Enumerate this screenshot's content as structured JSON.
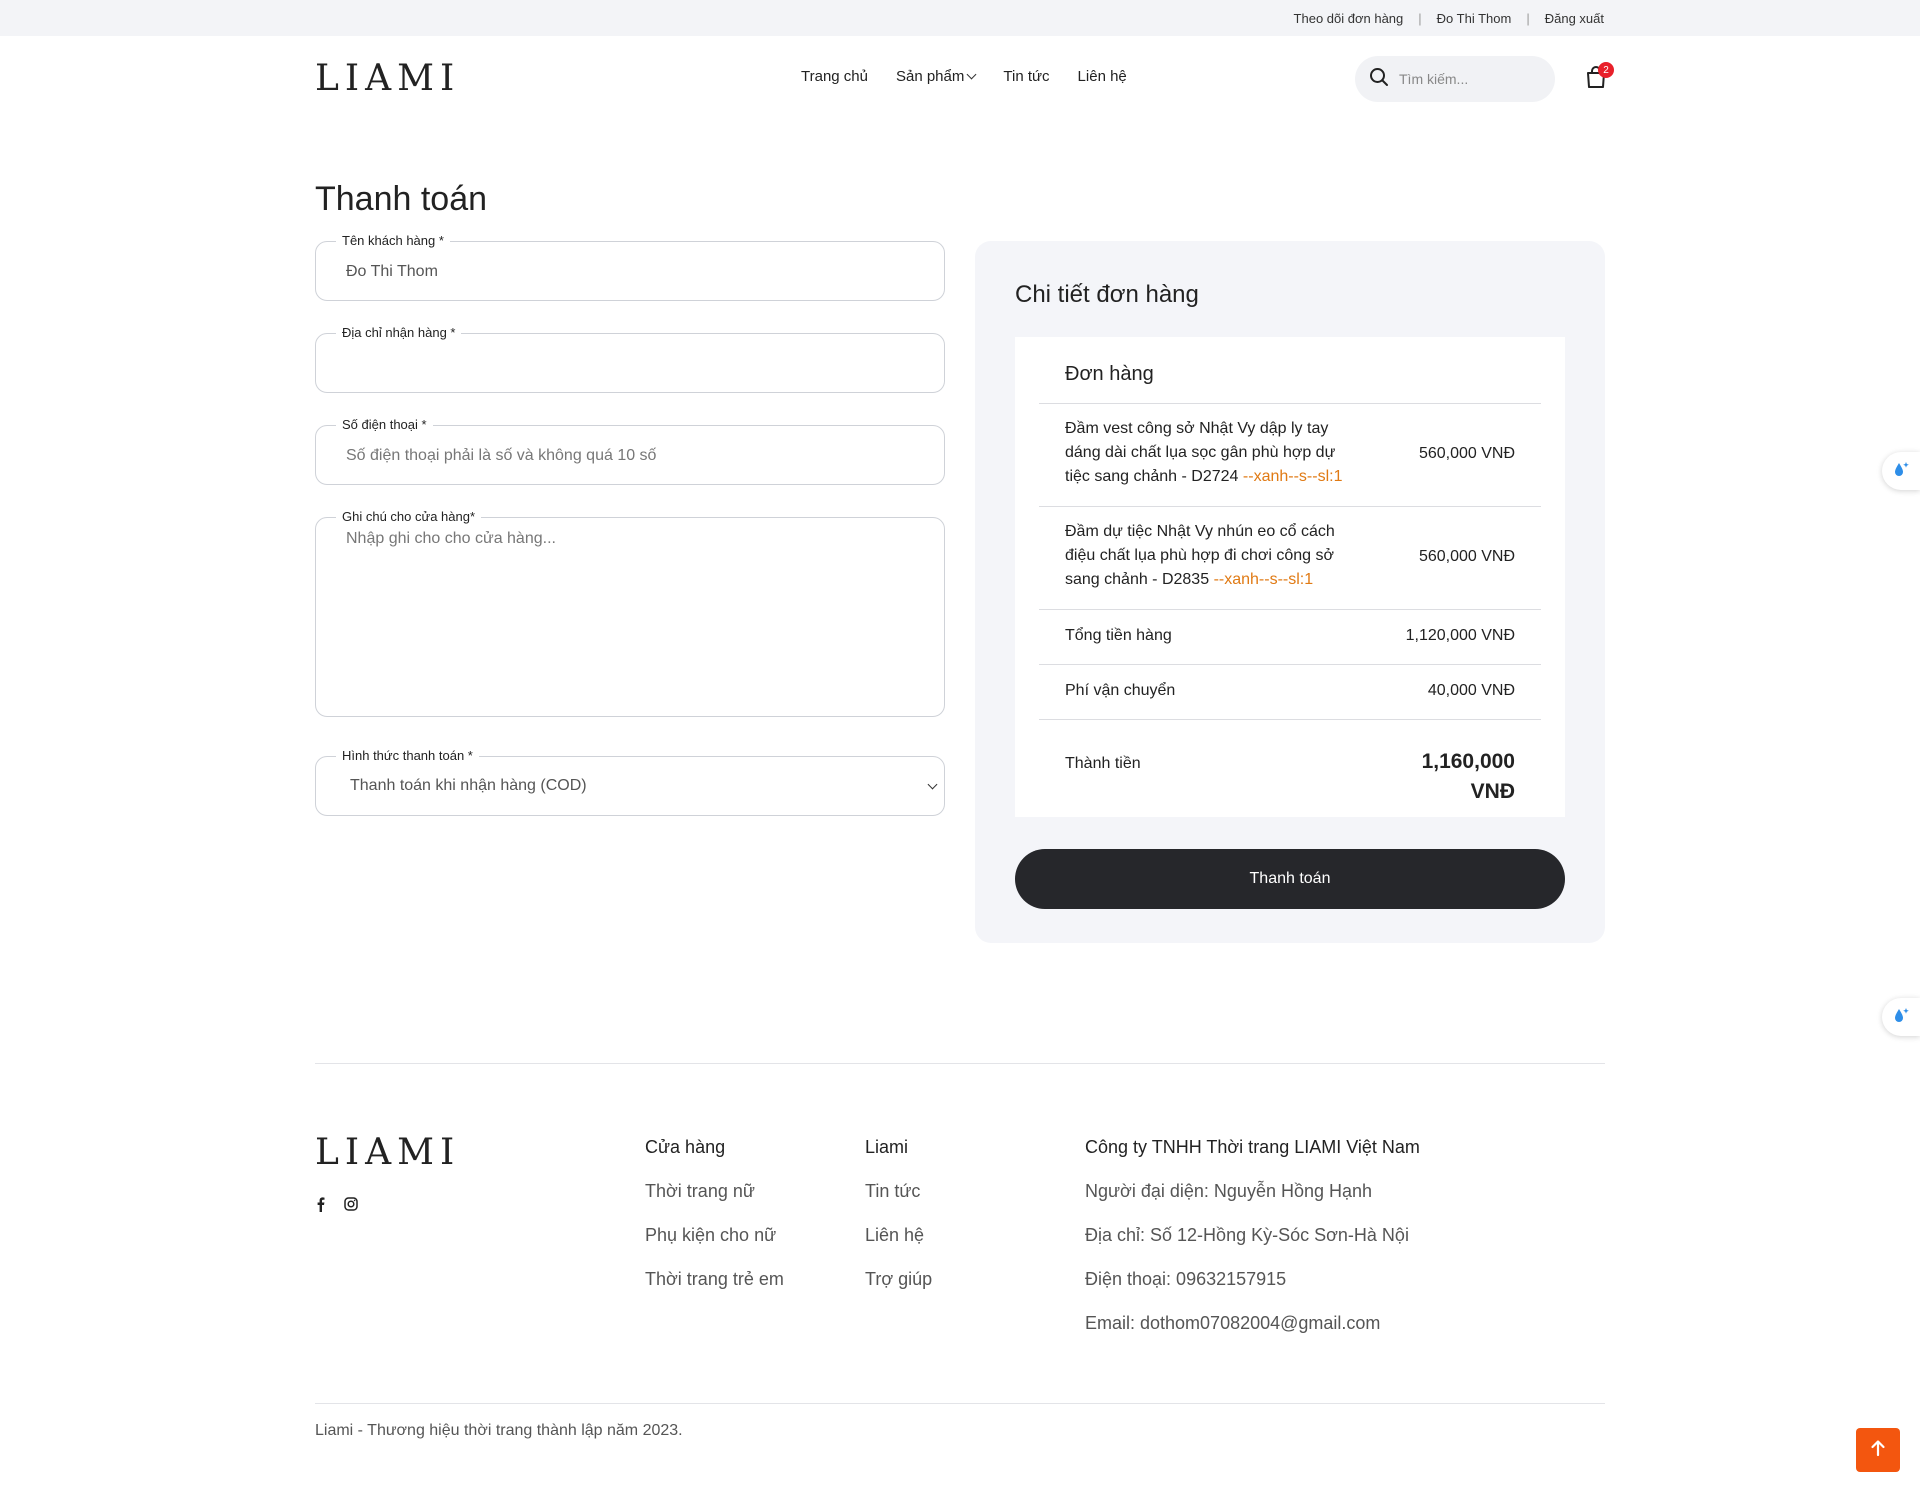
{
  "topbar": {
    "track_order": "Theo dõi đơn hàng",
    "user_name": "Đo Thi Thom",
    "logout": "Đăng xuất",
    "separator": "|"
  },
  "header": {
    "logo": "LIAMI",
    "nav": {
      "home": "Trang chủ",
      "products": "Sản phẩm",
      "news": "Tin tức",
      "contact": "Liên hệ"
    },
    "search_placeholder": "Tìm kiếm...",
    "cart_count": "2"
  },
  "page": {
    "title": "Thanh toán"
  },
  "form": {
    "customer_name": {
      "label": "Tên khách hàng *",
      "value": "Đo Thi Thom"
    },
    "address": {
      "label": "Địa chỉ nhận hàng *",
      "value": ""
    },
    "phone": {
      "label": "Số điện thoại *",
      "placeholder": "Số điện thoại phải là số và không quá 10 số"
    },
    "note": {
      "label": "Ghi chú cho cửa hàng*",
      "placeholder": "Nhập ghi cho cho cửa hàng..."
    },
    "payment": {
      "label": "Hình thức thanh toán *",
      "selected": "Thanh toán khi nhận hàng (COD)"
    }
  },
  "order": {
    "panel_title": "Chi tiết đơn hàng",
    "card_title": "Đơn hàng",
    "items": [
      {
        "name": "Đầm vest công sở Nhật Vy dập ly tay dáng dài chất lụa sọc gân phù hợp dự tiệc sang chảnh - D2724",
        "variant": "--xanh--s--sl:1",
        "price": "560,000 VNĐ"
      },
      {
        "name": "Đầm dự tiệc Nhật Vy nhún eo cổ cách điệu chất lụa phù hợp đi chơi công sở sang chảnh - D2835",
        "variant": "--xanh--s--sl:1",
        "price": "560,000 VNĐ"
      }
    ],
    "subtotal_label": "Tổng tiền hàng",
    "subtotal_value": "1,120,000 VNĐ",
    "shipping_label": "Phí vận chuyển",
    "shipping_value": "40,000 VNĐ",
    "total_label": "Thành tiền",
    "total_value": "1,160,000 VNĐ",
    "pay_button": "Thanh toán"
  },
  "footer": {
    "logo": "LIAMI",
    "social": [
      "facebook-icon",
      "instagram-icon"
    ],
    "store": {
      "heading": "Cửa hàng",
      "links": [
        "Thời trang nữ",
        "Phụ kiện cho nữ",
        "Thời trang trẻ em"
      ]
    },
    "liami": {
      "heading": "Liami",
      "links": [
        "Tin tức",
        "Liên hệ",
        "Trợ giúp"
      ]
    },
    "company": {
      "heading": "Công ty TNHH Thời trang LIAMI Việt Nam",
      "lines": [
        "Người đại diện: Nguyễn Hồng Hạnh",
        "Địa chỉ: Số 12-Hồng Kỳ-Sóc Sơn-Hà Nội",
        "Điện thoại: 09632157915",
        "Email: dothom07082004@gmail.com"
      ]
    },
    "copyright": "Liami - Thương hiệu thời trang thành lập năm 2023."
  },
  "colors": {
    "accent_orange": "#f3560f",
    "variant_orange": "#e07a14",
    "dark_button": "#26272b",
    "panel_bg": "#f4f5f9",
    "badge_red": "#e8202a"
  }
}
